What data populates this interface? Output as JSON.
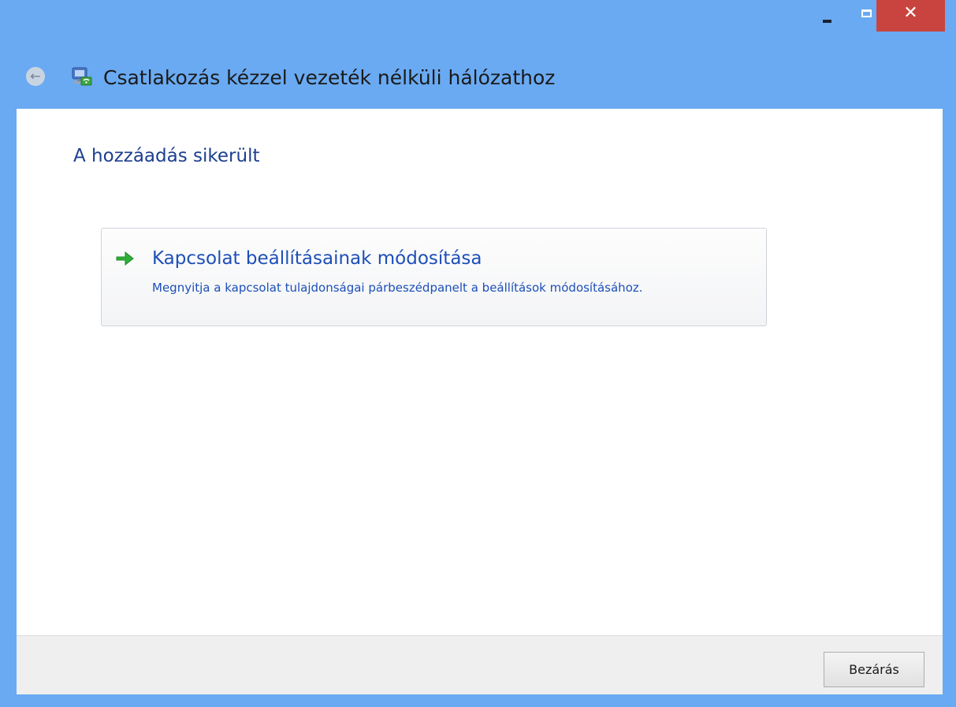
{
  "window": {
    "title": "Csatlakozás kézzel vezeték nélküli hálózathoz",
    "caption": {
      "minimize": "minimize-icon",
      "maximize": "maximize-icon",
      "close": "close-icon"
    }
  },
  "page": {
    "heading": "A hozzáadás sikerült",
    "command_link": {
      "icon": "green-arrow-icon",
      "title": "Kapcsolat beállításainak módosítása",
      "description": "Megnyitja a kapcsolat tulajdonságai párbeszédpanelt a beállítások módosításához."
    }
  },
  "footer": {
    "close_label": "Bezárás"
  },
  "colors": {
    "frame": "#6aaaf2",
    "close_button": "#c9443f",
    "link_text": "#1d4fb8",
    "heading_text": "#1c3f8f"
  }
}
